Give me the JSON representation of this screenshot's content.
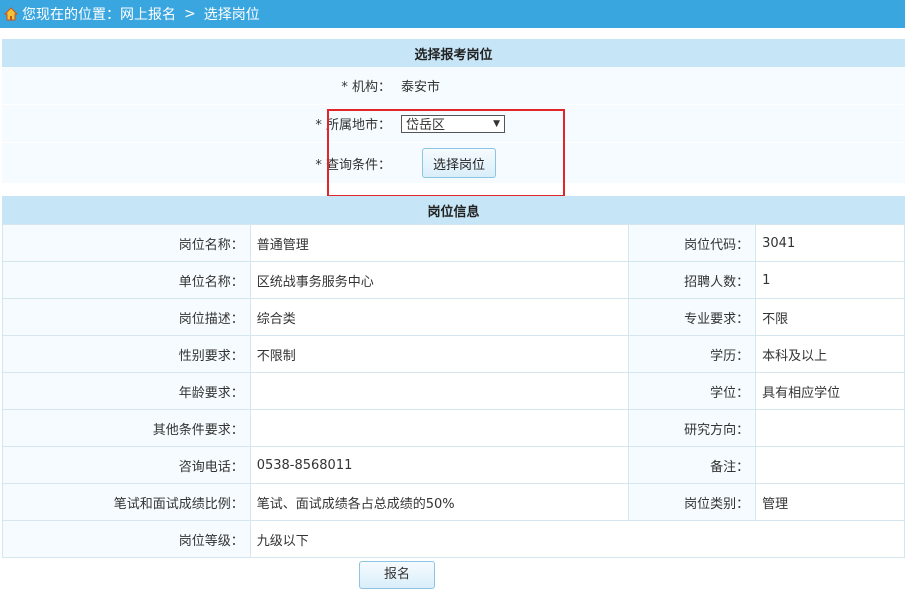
{
  "breadcrumb": {
    "prefix": "您现在的位置：",
    "level1": "网上报名",
    "separator": ">",
    "level2": "选择岗位"
  },
  "selection": {
    "title": "选择报考岗位",
    "org_label": "* 机构：",
    "org_value": "泰安市",
    "city_label": "* 所属地市：",
    "city_selected": "岱岳区",
    "query_label": "* 查询条件：",
    "select_button": "选择岗位"
  },
  "info": {
    "title": "岗位信息",
    "rows": [
      [
        "岗位名称：",
        "普通管理",
        "岗位代码：",
        "3041"
      ],
      [
        "单位名称：",
        "区统战事务服务中心",
        "招聘人数：",
        "1"
      ],
      [
        "岗位描述：",
        "综合类",
        "专业要求：",
        "不限"
      ],
      [
        "性别要求：",
        "不限制",
        "学历：",
        "本科及以上"
      ],
      [
        "年龄要求：",
        "",
        "学位：",
        "具有相应学位"
      ],
      [
        "其他条件要求：",
        "",
        "研究方向：",
        ""
      ],
      [
        "咨询电话：",
        "0538-8568011",
        "备注：",
        ""
      ],
      [
        "笔试和面试成绩比例：",
        "笔试、面试成绩各占总成绩的50%",
        "岗位类别：",
        "管理"
      ]
    ],
    "last_row": [
      "岗位等级：",
      "九级以下"
    ]
  },
  "submit_label": "报名",
  "colors": {
    "topbar": "#3aa6e0",
    "section_header": "#c6e6f7",
    "highlight": "#e0262a"
  }
}
